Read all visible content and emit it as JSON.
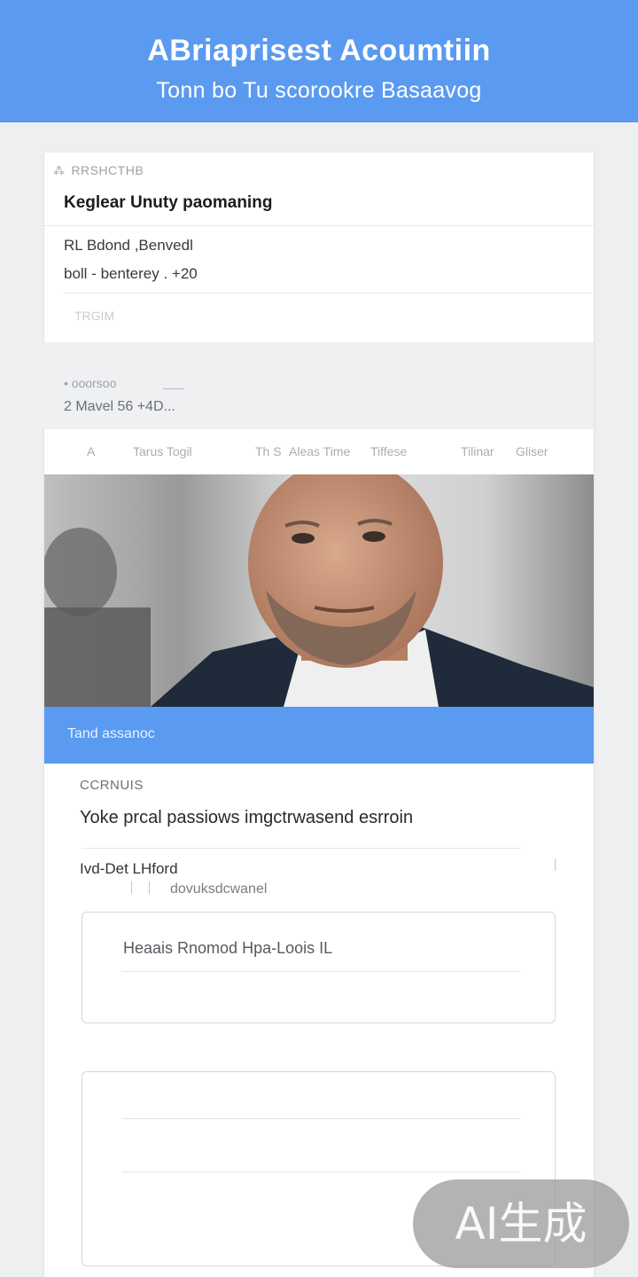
{
  "header": {
    "title": "ABriaprisest Acoumtiin",
    "subtitle": "Tonn bo Tu scorookre Basaavog"
  },
  "card": {
    "eyebrow": "RRSHCTHB",
    "title": "Keglear Unuty paomaning",
    "detail_line_1": "RL Bdond ,Benvedl",
    "detail_line_2": "boll - benterey . +20",
    "tag": "TRGIM",
    "band_item_1": "• ooorsoo",
    "band_item_2": "2 Mavel 56 +4D..."
  },
  "tabs": [
    {
      "label": "A"
    },
    {
      "label": "Tarus Togil"
    },
    {
      "label": "Th S"
    },
    {
      "label": "Aleas Time"
    },
    {
      "label": "Tiffese"
    },
    {
      "label": "Tilinar"
    },
    {
      "label": "Gliser"
    }
  ],
  "photo": {
    "description_icon": "portrait-photo",
    "colors": {
      "skin": "#c9967a",
      "suit": "#1f2a3a",
      "shirt": "#eeeeee",
      "beard": "#6f5a4c"
    }
  },
  "banner": {
    "text": "Tand assanoc"
  },
  "section": {
    "label": "CCRNUIS",
    "body": "Yoke prcal passiows imgctrwasend esrroin",
    "field_label": "Ivd-Det LHford",
    "field_hint": "dovuksdcwanel"
  },
  "input_box_1": {
    "value": "Heaais Rnomod Hpa-Loois IL"
  },
  "input_box_2": {
    "value": ""
  },
  "watermark": "AI生成",
  "colors": {
    "accent": "#5a9af0",
    "background": "#eeeff1",
    "card": "#ffffff"
  }
}
